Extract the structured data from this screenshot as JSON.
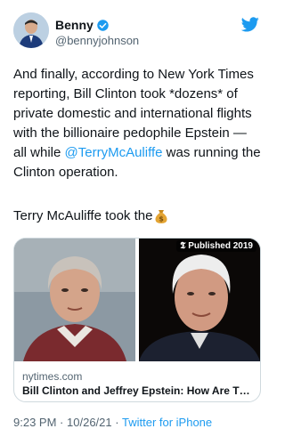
{
  "author": {
    "display_name": "Benny",
    "handle": "@bennyjohnson",
    "verified_icon": "verified-badge-icon",
    "avatar_icon": "avatar"
  },
  "tweet": {
    "text_before": "And finally, according to New York Times reporting, Bill Clinton took *dozens* of private domestic and international flights with the billionaire pedophile Epstein — all while ",
    "mention": "@TerryMcAuliffe",
    "text_after": " was running the Clinton operation.",
    "line2": "Terry McAuliffe took the",
    "emoji": "money-bag-icon"
  },
  "card": {
    "badge": "Published 2019",
    "domain": "nytimes.com",
    "title": "Bill Clinton and Jeffrey Epstein: How Are They Connected?"
  },
  "meta": {
    "time": "9:23 PM",
    "date": "10/26/21",
    "separator": "·",
    "source": "Twitter for iPhone"
  },
  "colors": {
    "accent": "#1d9bf0",
    "text": "#0f1419",
    "secondary": "#536471"
  }
}
